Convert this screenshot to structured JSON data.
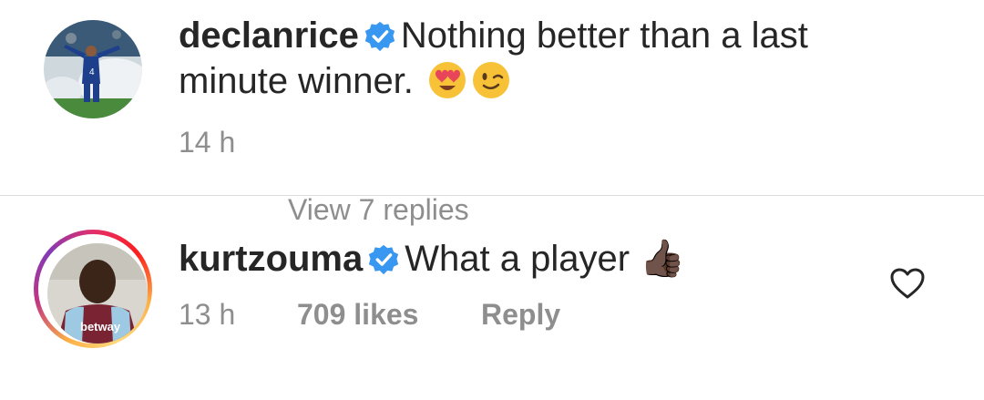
{
  "post": {
    "username": "declanrice",
    "caption": "Nothing better than a last minute winner.",
    "time": "14 h",
    "icons": [
      "verified-badge-icon",
      "heart-eyes-emoji",
      "winking-face-emoji"
    ]
  },
  "comment": {
    "username": "kurtzouma",
    "text": "What a player 👍🏿",
    "time": "13 h",
    "likes": "709 likes",
    "reply_label": "Reply",
    "icons": [
      "verified-badge-icon",
      "thumbs-up-emoji",
      "heart-outline-icon"
    ]
  },
  "more": {
    "label": "View 7 replies"
  },
  "colors": {
    "verified_blue": "#3897f0",
    "muted_text": "#8e8e8e",
    "divider": "#dbdbdb"
  }
}
